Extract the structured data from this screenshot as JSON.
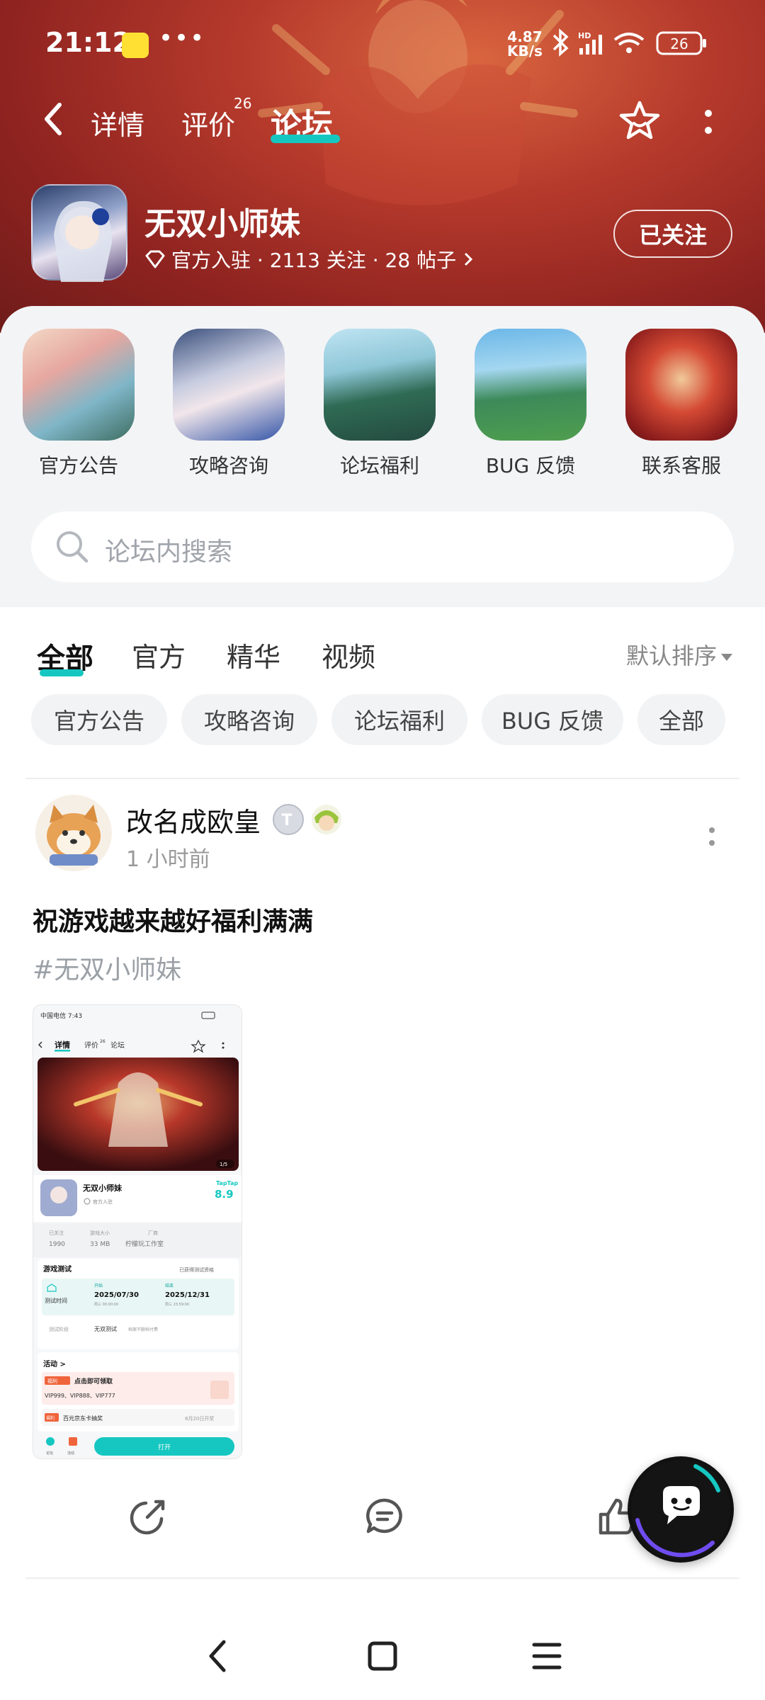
{
  "status_bar": {
    "time": "21:12",
    "dots": "•••",
    "speed_value": "4.87",
    "speed_unit": "KB/s",
    "battery": "26",
    "icons": [
      "notification-app-icon",
      "bluetooth-icon",
      "hd-signal-icon",
      "wifi-icon",
      "battery-icon"
    ]
  },
  "nav": {
    "tabs": [
      {
        "label": "详情",
        "active": false
      },
      {
        "label": "评价",
        "active": false,
        "superscript": "26"
      },
      {
        "label": "论坛",
        "active": true
      }
    ],
    "accent_color": "#16c7c1"
  },
  "forum": {
    "name": "无双小师妹",
    "meta": "官方入驻 · 2113 关注 · 28 帖子",
    "follow_label": "已关注"
  },
  "categories": [
    {
      "label": "官方公告",
      "icon": "announcement-art"
    },
    {
      "label": "攻略咨询",
      "icon": "guide-art"
    },
    {
      "label": "论坛福利",
      "icon": "welfare-art"
    },
    {
      "label": "BUG 反馈",
      "icon": "bug-art"
    },
    {
      "label": "联系客服",
      "icon": "support-art"
    }
  ],
  "search": {
    "placeholder": "论坛内搜索"
  },
  "filter_tabs": [
    {
      "label": "全部",
      "active": true
    },
    {
      "label": "官方",
      "active": false
    },
    {
      "label": "精华",
      "active": false
    },
    {
      "label": "视频",
      "active": false
    }
  ],
  "sort": {
    "label": "默认排序"
  },
  "chips": [
    "官方公告",
    "攻略咨询",
    "论坛福利",
    "BUG 反馈",
    "全部"
  ],
  "post": {
    "username": "改名成欧皇",
    "time": "1 小时前",
    "title": "祝游戏越来越好福利满满",
    "tag": "#无双小师妹",
    "shot": {
      "carrier": "中国电信 7:43",
      "tabs": [
        "详情",
        "评价",
        "论坛"
      ],
      "tab_sup": "26",
      "pager": "1/5",
      "game_name": "无双小师妹",
      "game_sub": "官方入驻",
      "score_brand": "TapTap",
      "score": "8.9",
      "stats": [
        {
          "label": "已关注",
          "value": "1990"
        },
        {
          "label": "游戏大小",
          "value": "33 MB"
        },
        {
          "label": "厂商",
          "value": "柠檬玩工作室"
        }
      ],
      "test_title": "游戏测试",
      "test_status": "已获得测试资格",
      "test_time_label": "测试时间",
      "start_label": "开始",
      "start_date": "2025/07/30",
      "start_time": "周三 00:00:00",
      "end_label": "结束",
      "end_date": "2025/12/31",
      "end_time": "周三 23:59:00",
      "phase_label": "测试阶段",
      "phase_value": "无双测试",
      "phase_note": "档案不删档付费",
      "activity_title": "活动 >",
      "activity_tag": "福利",
      "activity_text": "点击即可领取",
      "activity_codes": "VIP999、VIP888、VIP777",
      "lottery_tag": "福利",
      "lottery_text": "百元京东卡抽奖",
      "lottery_date": "8月20日开奖",
      "bottom_labels": [
        "论坛",
        "活动"
      ],
      "open_button": "打开"
    }
  }
}
